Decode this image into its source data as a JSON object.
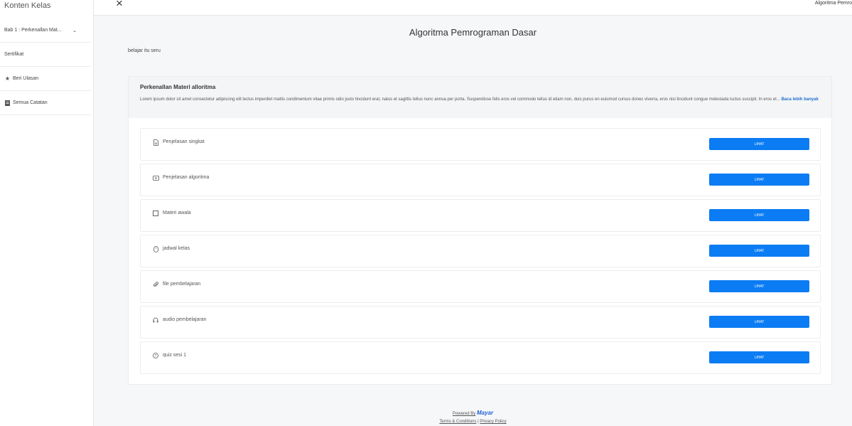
{
  "sidebar": {
    "title": "Konten Kelas",
    "items": [
      {
        "label": "Bab 1 : Perkenallan Mat...",
        "icon": "chevron-down-icon"
      },
      {
        "label": "Sertifikat",
        "icon": ""
      },
      {
        "label": "Beri Ulasan",
        "icon": "star-icon"
      },
      {
        "label": "Semua Catatan",
        "icon": "note-icon"
      }
    ]
  },
  "topbar": {
    "close_icon": "close-icon",
    "breadcrumb": "Algoritma Pemro"
  },
  "main": {
    "title": "Algoritma Pemrograman Dasar",
    "subtitle": "belajar itu seru",
    "description": {
      "heading": "Perkenallan Materi alloritma",
      "text": "Lorem ipsum dolor sit amet consectetur adipiscing elit lectus imperdiet mattis condimentum vitae primis odio justo tincidunt erat, natus et sagittis tellus nunc annua per porta. Suspendisse felis eros vel commodo tellus id etiam non, duis purus en euismod cursus donec viverra, eros nisi tincidunt congue molestada luctus suscipit. In eros et...",
      "read_more": "Baca lebih banyak"
    },
    "lessons": [
      {
        "label": "Penjelasan singkat",
        "icon": "document-icon",
        "button": "LIHAT"
      },
      {
        "label": "Penjelasan algoritma",
        "icon": "video-icon",
        "button": "LIHAT"
      },
      {
        "label": "Materi awala",
        "icon": "checkbox-icon",
        "button": "LIHAT"
      },
      {
        "label": "jadwal kelas",
        "icon": "mouse-icon",
        "button": "LIHAT"
      },
      {
        "label": "file pembelajaran",
        "icon": "paperclip-icon",
        "button": "LIHAT"
      },
      {
        "label": "audio pembelajaran",
        "icon": "headphones-icon",
        "button": "LIHAT"
      },
      {
        "label": "quiz sesi 1",
        "icon": "question-icon",
        "button": "LIHAT"
      }
    ]
  },
  "footer": {
    "powered_by": "Powered By",
    "brand": "Mayar",
    "terms": "Terms & Conditions",
    "separator": "|",
    "privacy": "Privacy Policy"
  }
}
